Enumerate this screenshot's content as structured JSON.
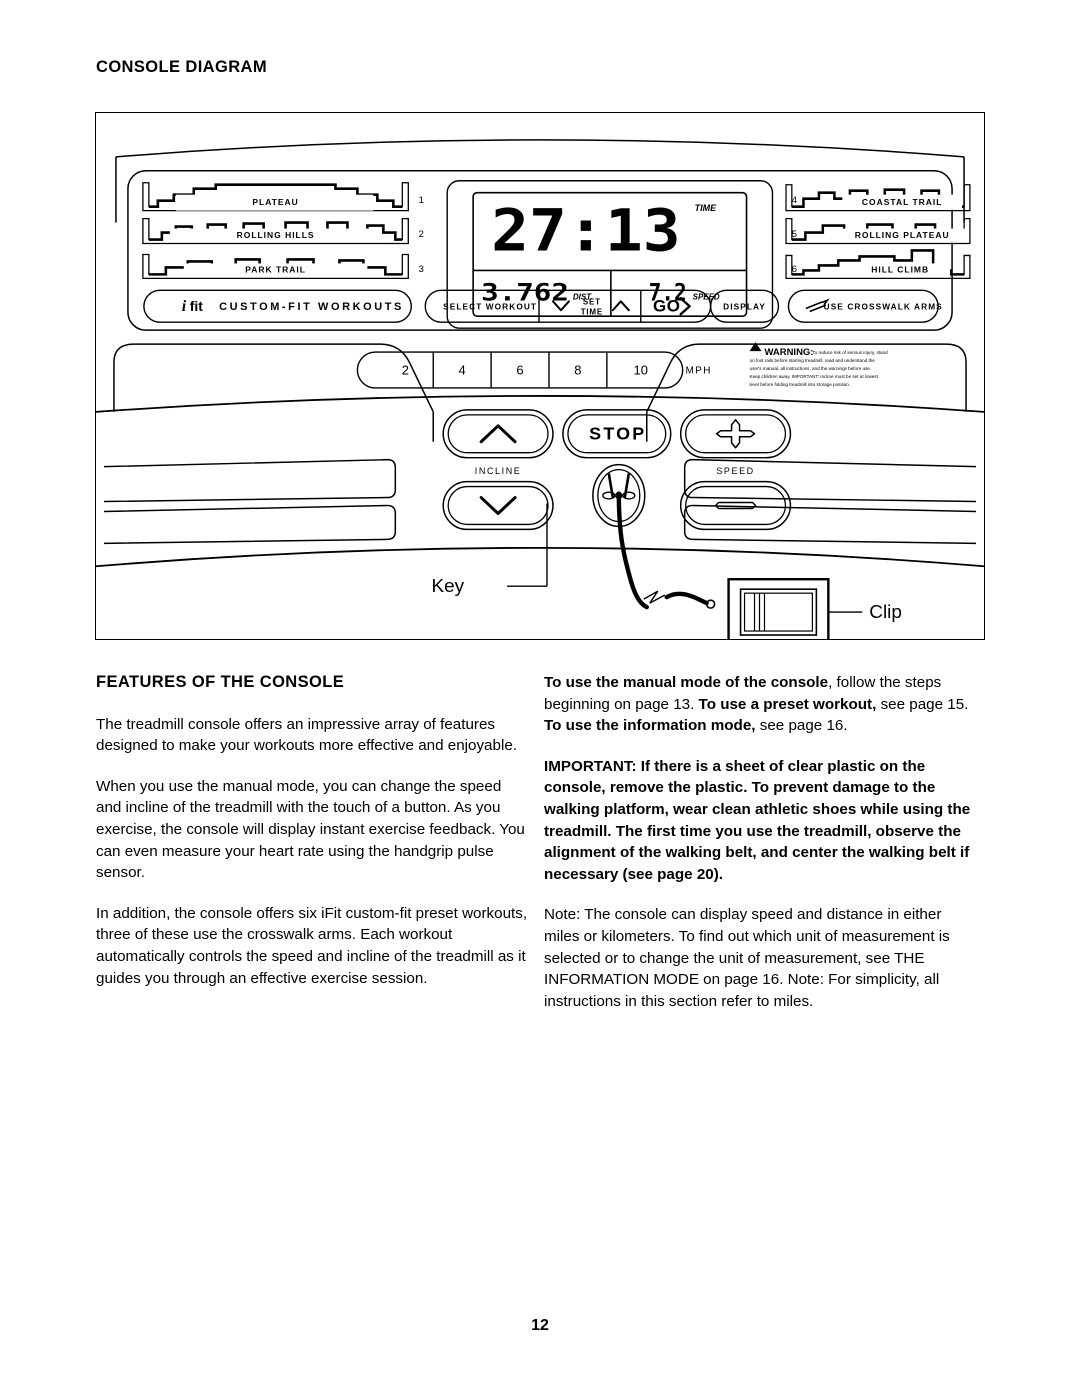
{
  "page": {
    "number": "12",
    "section_title": "CONSOLE DIAGRAM"
  },
  "console": {
    "left_profiles": [
      {
        "label": "PLATEAU",
        "number": "1"
      },
      {
        "label": "ROLLING HILLS",
        "number": "2"
      },
      {
        "label": "PARK TRAIL",
        "number": "3"
      }
    ],
    "right_profiles": [
      {
        "label": "COASTAL TRAIL",
        "number": "4"
      },
      {
        "label": "ROLLING PLATEAU",
        "number": "5"
      },
      {
        "label": "HILL CLIMB",
        "number": "6"
      }
    ],
    "display": {
      "time_value": "27:13",
      "time_label": "TIME",
      "distance_value": "3.762",
      "distance_label": "DIST.",
      "speed_value": "7.2",
      "speed_label": "SPEED"
    },
    "buttons": {
      "ifit_mark": "i",
      "ifit_fit": "fit",
      "ifit_workouts": "CUSTOM-FIT WORKOUTS",
      "select_workout": "SELECT WORKOUT",
      "set": "SET",
      "time": "TIME",
      "go": "GO",
      "display": "DISPLAY",
      "use_crosswalk_arms": "USE CROSSWALK ARMS",
      "stop": "STOP",
      "incline": "INCLINE",
      "speed": "SPEED"
    },
    "speed_keys": [
      "2",
      "4",
      "6",
      "8",
      "10"
    ],
    "speed_unit": "MPH",
    "warning": {
      "title": "WARNING:",
      "body": "To reduce risk of serious injury, stand on foot rails before starting treadmill, read and understand the user's manual, all instructions, and the warnings before use. Keep children away. IMPORTANT: Incline must be set at lowest level before folding treadmill into storage position.",
      "lines": [
        "To reduce risk of serious injury, stand",
        "on foot rails before starting treadmill, read and understand the",
        "user's manual, all instructions, and the warnings before use.",
        "Keep children away. IMPORTANT: Incline must be set at lowest",
        "level before folding treadmill into storage position."
      ]
    },
    "callouts": {
      "key": "Key",
      "clip": "Clip"
    }
  },
  "features": {
    "heading": "FEATURES OF THE CONSOLE",
    "paragraphs": [
      "The treadmill console offers an impressive array of features designed to make your workouts more effective and enjoyable.",
      "When you use the manual mode, you can change the speed and incline of the treadmill with the touch of a button. As you exercise, the console will display instant exercise feedback. You can even measure your heart rate using the handgrip pulse sensor.",
      "In addition, the console offers six iFit custom-fit preset workouts, three of these use the crosswalk arms. Each workout automatically controls the speed and incline of the treadmill as it guides you through an effective exercise session."
    ]
  },
  "modes": {
    "manual_bold": "To use the manual mode of the console",
    "manual_rest": ", follow the steps beginning on page 13. ",
    "preset_bold": "To use a preset workout,",
    "preset_rest": " see page 15. ",
    "info_bold": "To use the information mode,",
    "info_rest": " see page 16.",
    "important": "IMPORTANT: If there is a sheet of clear plastic on the console, remove the plastic. To prevent damage to the walking platform, wear clean athletic shoes while using the treadmill. The first time you use the treadmill, observe the alignment of the walking belt, and center the walking belt if necessary (see page 20).",
    "note": "Note: The console can display speed and distance in either miles or kilometers. To find out which unit of measurement is selected or to change the unit of measurement, see THE INFORMATION MODE on page 16. Note: For simplicity, all instructions in this section refer to miles."
  }
}
